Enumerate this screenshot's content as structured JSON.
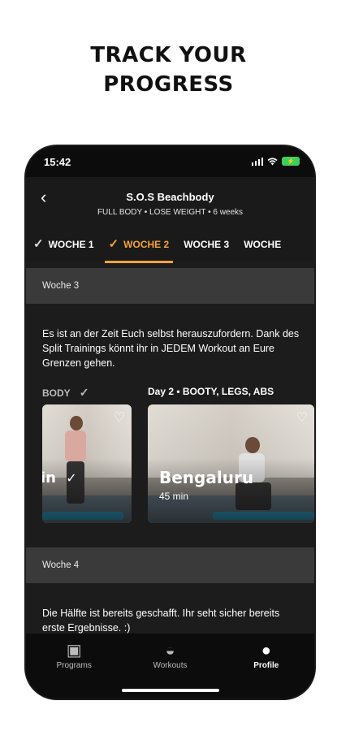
{
  "headline": [
    "TRACK YOUR",
    "PROGRESS"
  ],
  "status": {
    "time": "15:42"
  },
  "header": {
    "back_icon": "chevron-left-icon",
    "title": "S.O.S Beachbody",
    "subtitle": "FULL BODY • LOSE WEIGHT • 6 weeks"
  },
  "tabs": [
    {
      "label": "WOCHE 1",
      "checked": true,
      "active": false
    },
    {
      "label": "WOCHE 2",
      "checked": true,
      "active": true
    },
    {
      "label": "WOCHE 3",
      "checked": false,
      "active": false
    },
    {
      "label": "WOCHE",
      "checked": false,
      "active": false
    }
  ],
  "week3": {
    "header": "Woche 3",
    "description": "Es ist an der Zeit Euch selbst herauszufordern. Dank des Split Trainings könnt ihr in JEDEM Workout an Eure Grenzen gehen.",
    "day_left": "BODY",
    "day_right": "Day 2 • BOOTY, LEGS, ABS",
    "card_left_name": "in",
    "card_right_name": "Bengaluru",
    "card_right_duration": "45 min"
  },
  "week4": {
    "header": "Woche 4",
    "description": "Die Hälfte ist bereits geschafft. Ihr seht sicher bereits erste Ergebnisse. :)"
  },
  "nav": {
    "programs": "Programs",
    "workouts": "Workouts",
    "profile": "Profile"
  },
  "colors": {
    "accent": "#f5a33b",
    "background": "#1c1c1c",
    "section": "#3a3a3a"
  }
}
